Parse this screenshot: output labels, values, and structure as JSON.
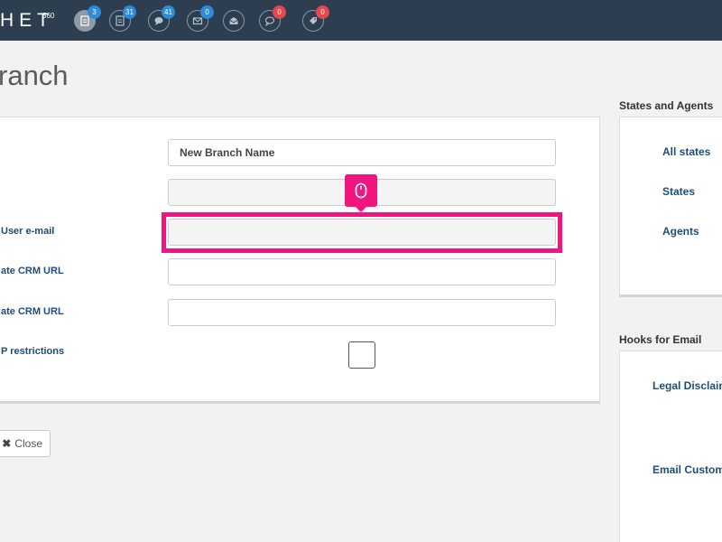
{
  "topbar": {
    "logo": "HET",
    "logo_sup": "360",
    "icons": [
      {
        "name": "document-icon",
        "badge": "3",
        "badge_color": "blue"
      },
      {
        "name": "invoice-icon",
        "badge": "31",
        "badge_color": "blue"
      },
      {
        "name": "chat-icon",
        "badge": "41",
        "badge_color": "blue"
      },
      {
        "name": "mail-icon",
        "badge": "0",
        "badge_color": "blue"
      },
      {
        "name": "open-mail-icon",
        "badge": "",
        "badge_color": ""
      },
      {
        "name": "comment-icon",
        "badge": "0",
        "badge_color": "red"
      },
      {
        "name": "tag-icon",
        "badge": "0",
        "badge_color": "red"
      }
    ]
  },
  "page": {
    "title": "ranch"
  },
  "form": {
    "branch_name_value": "New Branch Name",
    "labels": {
      "user_email": "User e-mail",
      "crm_url_1": "ate CRM URL",
      "crm_url_2": "ate CRM URL",
      "ip_restrictions": "P restrictions"
    }
  },
  "actions": {
    "close_label": "Close"
  },
  "states_agents": {
    "title": "States and Agents",
    "links": [
      "All states",
      "States",
      "Agents"
    ]
  },
  "hooks": {
    "title": "Hooks for Email",
    "links": [
      "Legal Disclaim",
      "Email Custom"
    ]
  },
  "colors": {
    "topbar": "#2d3e50",
    "highlight": "#f0157f",
    "link": "#1f4d7a",
    "badge_blue": "#2e8bd8",
    "badge_red": "#e5474c"
  }
}
